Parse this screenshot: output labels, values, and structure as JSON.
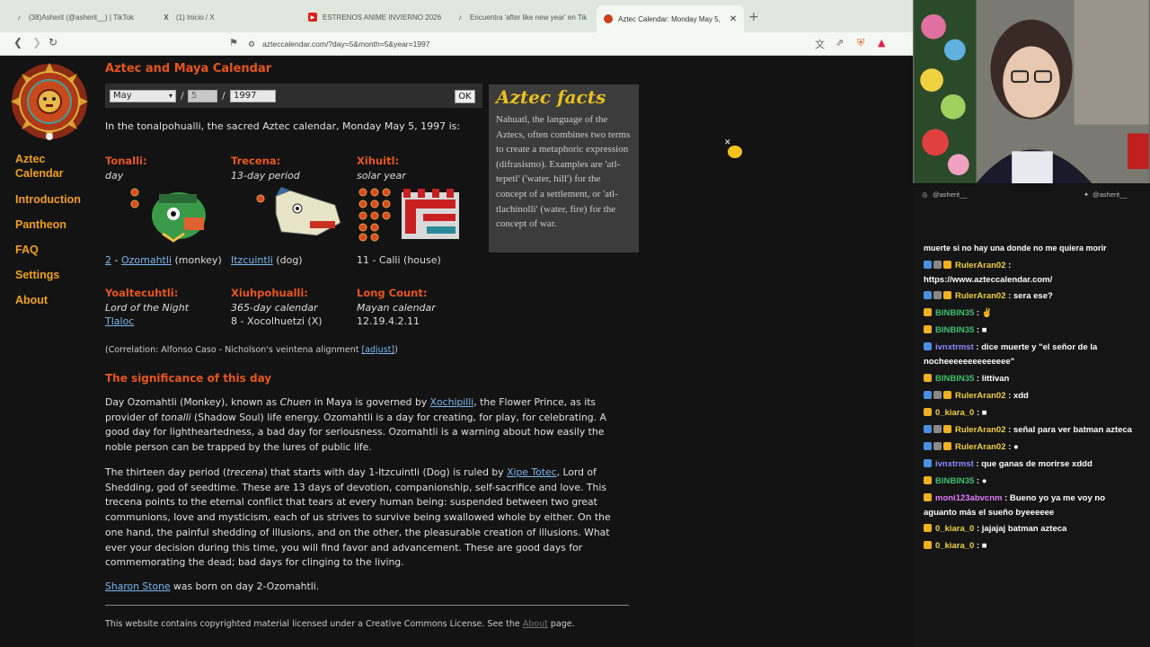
{
  "browser": {
    "tabs": [
      {
        "title": "(38)Asherit (@asherit__) | TikTok",
        "icon": "tiktok-icon"
      },
      {
        "title": "(1) Inicio / X",
        "icon": "x-icon"
      },
      {
        "title": "ESTRENOS ANIME INVIERNO 2026 -",
        "icon": "youtube-icon"
      },
      {
        "title": "Encuentra 'after like new year' en Tik",
        "icon": "tiktok-icon"
      },
      {
        "title": "Aztec Calendar: Monday May 5,",
        "icon": "aztec-icon"
      }
    ],
    "url": "azteccalendar.com/?day=5&month=5&year=1997"
  },
  "site": {
    "title": "Aztec and Maya Calendar",
    "nav": [
      "Aztec Calendar",
      "Introduction",
      "Pantheon",
      "FAQ",
      "Settings",
      "About"
    ],
    "form": {
      "month": "May",
      "day": "5",
      "year": "1997",
      "ok": "OK"
    },
    "intro": "In the tonalpohualli, the sacred Aztec calendar, Monday May 5, 1997 is:",
    "tonalli": {
      "label": "Tonalli:",
      "sub": "day",
      "num": "2",
      "sep": " - ",
      "name": "Ozomahtli",
      "meaning": " (monkey)"
    },
    "trecena": {
      "label": "Trecena:",
      "sub": "13-day period",
      "name": "Itzcuintli",
      "meaning": " (dog)"
    },
    "xihuitl": {
      "label": "Xihuitl:",
      "sub": "solar year",
      "val": "11 - Calli (house)"
    },
    "yoaltecuhtli": {
      "label": "Yoaltecuhtli:",
      "sub": "Lord of the Night",
      "val": "Tlaloc"
    },
    "xiuhpohualli": {
      "label": "Xiuhpohualli:",
      "sub": "365-day calendar",
      "val": "8 - Xocolhuetzi (X)"
    },
    "longcount": {
      "label": "Long Count:",
      "sub": "Mayan calendar",
      "val": "12.19.4.2.11"
    },
    "correlation": "(Correlation: Alfonso Caso - Nicholson's veintena alignment ",
    "adjust": "[adjust]",
    "correlation_end": ")",
    "significance_title": "The significance of this day",
    "p1": {
      "a": "Day Ozomahtli (Monkey), known as ",
      "b": "Chuen",
      "c": " in Maya is governed by ",
      "link": "Xochipilli",
      "d": ", the Flower Prince, as its provider of ",
      "e": "tonalli",
      "f": " (Shadow Soul) life energy. Ozomahtli is a day for creating, for play, for celebrating. A good day for lightheartedness, a bad day for seriousness. Ozomahtli is a warning about how easily the noble person can be trapped by the lures of public life."
    },
    "p2": {
      "a": "The thirteen day period (",
      "b": "trecena",
      "c": ") that starts with day 1-Itzcuintli (Dog) is ruled by ",
      "link": "Xipe Totec",
      "d": ", Lord of Shedding, god of seedtime. These are 13 days of devotion, companionship, self-sacrifice and love. This trecena points to the eternal conflict that tears at every human being: suspended between two great communions, love and mysticism, each of us strives to survive being swallowed whole by either. On the one hand, the painful shedding of illusions, and on the other, the pleasurable creation of illusions. What ever your decision during this time, you will find favor and advancement. These are good days for commemorating the dead; bad days for clinging to the living."
    },
    "p3": {
      "link": "Sharon Stone",
      "rest": " was born on day 2-Ozomahtli."
    },
    "footer": {
      "a": "This website contains copyrighted material licensed under a Creative Commons License. See the ",
      "link": "About",
      "b": " page."
    },
    "facts": {
      "title": "Aztec facts",
      "text": "Nahuatl, the language of the Aztecs, often combines two terms to create a metaphoric expression (difrasismo). Examples are 'atl-tepetl' ('water, hill') for the concept of a settlement, or 'atl-tlachinolli' (water, fire) for the concept of war."
    }
  },
  "stream": {
    "handle_left": "@asherit__",
    "handle_right": "@asherit__",
    "chat": [
      {
        "user": "",
        "text": "muerte si no hay una donde no me quiera morir",
        "color": "#ffffff"
      },
      {
        "user": "RulerAran02",
        "text": ":",
        "cont": "https://www.azteccalendar.com/",
        "color": "#f0d040",
        "badges": [
          "#4a90e2",
          "#888888",
          "#f0b020"
        ]
      },
      {
        "user": "RulerAran02",
        "text": ": sera ese?",
        "color": "#f0d040",
        "badges": [
          "#4a90e2",
          "#888888",
          "#f0b020"
        ]
      },
      {
        "user": "BINBIN35",
        "text": ": ✌",
        "color": "#40c070",
        "badges": [
          "#f0b020"
        ]
      },
      {
        "user": "BINBIN35",
        "text": ": ■",
        "color": "#40c070",
        "badges": [
          "#f0b020"
        ]
      },
      {
        "user": "ivnxtrmst",
        "text": ": dice muerte y \"el señor de la",
        "cont": "nocheeeeeeeeeeeeee\"",
        "color": "#8a8aff",
        "badges": [
          "#4a90e2"
        ]
      },
      {
        "user": "BINBIN35",
        "text": ": littivan",
        "color": "#40c070",
        "badges": [
          "#f0b020"
        ]
      },
      {
        "user": "RulerAran02",
        "text": ": xdd",
        "color": "#f0d040",
        "badges": [
          "#4a90e2",
          "#888888",
          "#f0b020"
        ]
      },
      {
        "user": "0_kiara_0",
        "text": ": ■",
        "color": "#f0d040",
        "badges": [
          "#f0b020"
        ]
      },
      {
        "user": "RulerAran02",
        "text": ": señal para ver batman azteca",
        "color": "#f0d040",
        "badges": [
          "#4a90e2",
          "#888888",
          "#f0b020"
        ]
      },
      {
        "user": "RulerAran02",
        "text": ": ●",
        "color": "#f0d040",
        "badges": [
          "#4a90e2",
          "#888888",
          "#f0b020"
        ]
      },
      {
        "user": "ivnxtrmst",
        "text": ": que ganas de morirse xddd",
        "color": "#8a8aff",
        "badges": [
          "#4a90e2"
        ]
      },
      {
        "user": "BINBIN35",
        "text": ": ●",
        "color": "#40c070",
        "badges": [
          "#f0b020"
        ]
      },
      {
        "user": "moni123abvcnm",
        "text": ": Bueno yo ya me voy no",
        "cont": "aguanto más el sueño byeeeeee",
        "color": "#e07aff",
        "badges": [
          "#f0b020"
        ]
      },
      {
        "user": "0_kiara_0",
        "text": ": jajajaj batman azteca",
        "color": "#f0d040",
        "badges": [
          "#f0b020"
        ]
      },
      {
        "user": "0_kiara_0",
        "text": ": ■",
        "color": "#f0d040",
        "badges": [
          "#f0b020"
        ]
      }
    ]
  },
  "colors": {
    "accent_orange": "#e8561c",
    "nav_gold": "#f2a018",
    "link": "#7ab8f0",
    "facts_title": "#e8c020"
  }
}
